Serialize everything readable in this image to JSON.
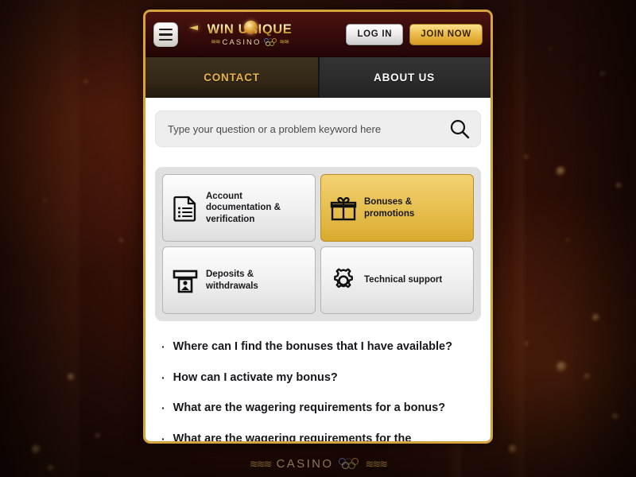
{
  "site": {
    "logo": {
      "top_text": "WIN UNIQUE",
      "bottom_text": "CASINO",
      "icon": "casino-rings-icon"
    },
    "menu_icon": "hamburger-menu-icon",
    "buttons": {
      "login": "LOG IN",
      "join": "JOIN NOW"
    }
  },
  "tabs": [
    {
      "label": "CONTACT",
      "active": true
    },
    {
      "label": "ABOUT US",
      "active": false
    }
  ],
  "search": {
    "placeholder": "Type your question or a problem keyword here",
    "value": "",
    "icon": "search-icon"
  },
  "categories": [
    {
      "label": "Account documentation & verification",
      "icon": "document-list-icon",
      "selected": false
    },
    {
      "label": "Bonuses & promotions",
      "icon": "gift-box-icon",
      "selected": true
    },
    {
      "label": "Deposits & withdrawals",
      "icon": "atm-machine-icon",
      "selected": false
    },
    {
      "label": "Technical support",
      "icon": "gear-icon",
      "selected": false
    }
  ],
  "faq": {
    "bullet": "·",
    "items": [
      "Where can I find the bonuses that I have available?",
      "How can I activate my bonus?",
      "What are the wagering requirements for a bonus?",
      "What are the wagering requirements for the"
    ]
  },
  "watermark": {
    "text": "CASINO",
    "icon": "casino-rings-icon"
  },
  "colors": {
    "accent_gold": "#e8b44a",
    "frame_border": "#d6a33c",
    "header_maroon": "#3a0d0c",
    "card_selected": "#e9c255",
    "background": "#2a0f08"
  }
}
